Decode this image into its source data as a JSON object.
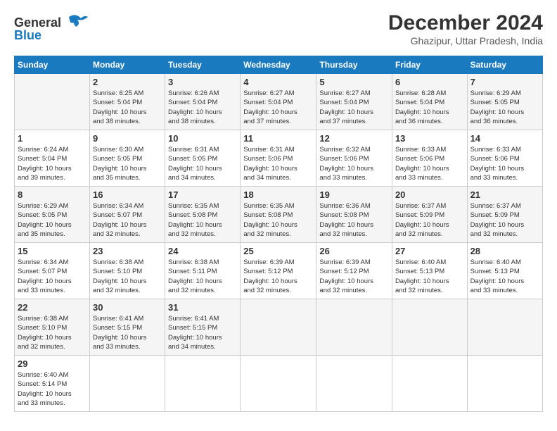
{
  "header": {
    "logo_line1": "General",
    "logo_line2": "Blue",
    "title": "December 2024",
    "subtitle": "Ghazipur, Uttar Pradesh, India"
  },
  "calendar": {
    "days_of_week": [
      "Sunday",
      "Monday",
      "Tuesday",
      "Wednesday",
      "Thursday",
      "Friday",
      "Saturday"
    ],
    "weeks": [
      [
        {
          "day": "",
          "info": ""
        },
        {
          "day": "2",
          "info": "Sunrise: 6:25 AM\nSunset: 5:04 PM\nDaylight: 10 hours\nand 38 minutes."
        },
        {
          "day": "3",
          "info": "Sunrise: 6:26 AM\nSunset: 5:04 PM\nDaylight: 10 hours\nand 38 minutes."
        },
        {
          "day": "4",
          "info": "Sunrise: 6:27 AM\nSunset: 5:04 PM\nDaylight: 10 hours\nand 37 minutes."
        },
        {
          "day": "5",
          "info": "Sunrise: 6:27 AM\nSunset: 5:04 PM\nDaylight: 10 hours\nand 37 minutes."
        },
        {
          "day": "6",
          "info": "Sunrise: 6:28 AM\nSunset: 5:04 PM\nDaylight: 10 hours\nand 36 minutes."
        },
        {
          "day": "7",
          "info": "Sunrise: 6:29 AM\nSunset: 5:05 PM\nDaylight: 10 hours\nand 36 minutes."
        }
      ],
      [
        {
          "day": "1",
          "info": "Sunrise: 6:24 AM\nSunset: 5:04 PM\nDaylight: 10 hours\nand 39 minutes."
        },
        {
          "day": "9",
          "info": "Sunrise: 6:30 AM\nSunset: 5:05 PM\nDaylight: 10 hours\nand 35 minutes."
        },
        {
          "day": "10",
          "info": "Sunrise: 6:31 AM\nSunset: 5:05 PM\nDaylight: 10 hours\nand 34 minutes."
        },
        {
          "day": "11",
          "info": "Sunrise: 6:31 AM\nSunset: 5:06 PM\nDaylight: 10 hours\nand 34 minutes."
        },
        {
          "day": "12",
          "info": "Sunrise: 6:32 AM\nSunset: 5:06 PM\nDaylight: 10 hours\nand 33 minutes."
        },
        {
          "day": "13",
          "info": "Sunrise: 6:33 AM\nSunset: 5:06 PM\nDaylight: 10 hours\nand 33 minutes."
        },
        {
          "day": "14",
          "info": "Sunrise: 6:33 AM\nSunset: 5:06 PM\nDaylight: 10 hours\nand 33 minutes."
        }
      ],
      [
        {
          "day": "8",
          "info": "Sunrise: 6:29 AM\nSunset: 5:05 PM\nDaylight: 10 hours\nand 35 minutes."
        },
        {
          "day": "16",
          "info": "Sunrise: 6:34 AM\nSunset: 5:07 PM\nDaylight: 10 hours\nand 32 minutes."
        },
        {
          "day": "17",
          "info": "Sunrise: 6:35 AM\nSunset: 5:08 PM\nDaylight: 10 hours\nand 32 minutes."
        },
        {
          "day": "18",
          "info": "Sunrise: 6:35 AM\nSunset: 5:08 PM\nDaylight: 10 hours\nand 32 minutes."
        },
        {
          "day": "19",
          "info": "Sunrise: 6:36 AM\nSunset: 5:08 PM\nDaylight: 10 hours\nand 32 minutes."
        },
        {
          "day": "20",
          "info": "Sunrise: 6:37 AM\nSunset: 5:09 PM\nDaylight: 10 hours\nand 32 minutes."
        },
        {
          "day": "21",
          "info": "Sunrise: 6:37 AM\nSunset: 5:09 PM\nDaylight: 10 hours\nand 32 minutes."
        }
      ],
      [
        {
          "day": "15",
          "info": "Sunrise: 6:34 AM\nSunset: 5:07 PM\nDaylight: 10 hours\nand 33 minutes."
        },
        {
          "day": "23",
          "info": "Sunrise: 6:38 AM\nSunset: 5:10 PM\nDaylight: 10 hours\nand 32 minutes."
        },
        {
          "day": "24",
          "info": "Sunrise: 6:38 AM\nSunset: 5:11 PM\nDaylight: 10 hours\nand 32 minutes."
        },
        {
          "day": "25",
          "info": "Sunrise: 6:39 AM\nSunset: 5:12 PM\nDaylight: 10 hours\nand 32 minutes."
        },
        {
          "day": "26",
          "info": "Sunrise: 6:39 AM\nSunset: 5:12 PM\nDaylight: 10 hours\nand 32 minutes."
        },
        {
          "day": "27",
          "info": "Sunrise: 6:40 AM\nSunset: 5:13 PM\nDaylight: 10 hours\nand 32 minutes."
        },
        {
          "day": "28",
          "info": "Sunrise: 6:40 AM\nSunset: 5:13 PM\nDaylight: 10 hours\nand 33 minutes."
        }
      ],
      [
        {
          "day": "22",
          "info": "Sunrise: 6:38 AM\nSunset: 5:10 PM\nDaylight: 10 hours\nand 32 minutes."
        },
        {
          "day": "30",
          "info": "Sunrise: 6:41 AM\nSunset: 5:15 PM\nDaylight: 10 hours\nand 33 minutes."
        },
        {
          "day": "31",
          "info": "Sunrise: 6:41 AM\nSunset: 5:15 PM\nDaylight: 10 hours\nand 34 minutes."
        },
        {
          "day": "",
          "info": ""
        },
        {
          "day": "",
          "info": ""
        },
        {
          "day": "",
          "info": ""
        },
        {
          "day": "",
          "info": ""
        }
      ],
      [
        {
          "day": "29",
          "info": "Sunrise: 6:40 AM\nSunset: 5:14 PM\nDaylight: 10 hours\nand 33 minutes."
        },
        {
          "day": "",
          "info": ""
        },
        {
          "day": "",
          "info": ""
        },
        {
          "day": "",
          "info": ""
        },
        {
          "day": "",
          "info": ""
        },
        {
          "day": "",
          "info": ""
        },
        {
          "day": "",
          "info": ""
        }
      ]
    ]
  }
}
